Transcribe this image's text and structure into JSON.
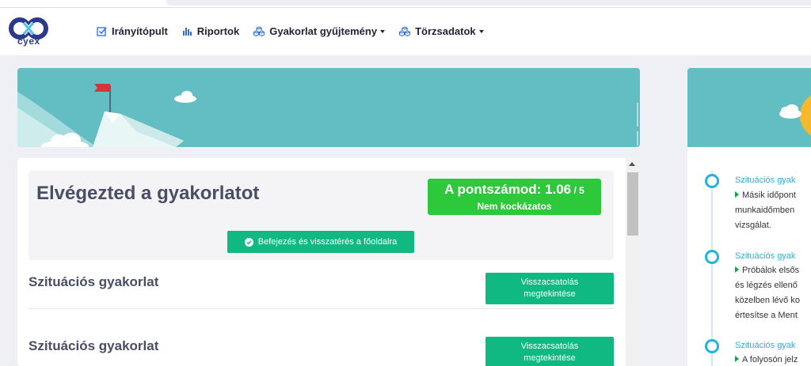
{
  "app": {
    "logo_text": "cyex"
  },
  "nav": {
    "items": [
      {
        "label": "Irányítópult",
        "icon": "checkbox-icon",
        "dropdown": false
      },
      {
        "label": "Riportok",
        "icon": "bar-chart-icon",
        "dropdown": false
      },
      {
        "label": "Gyakorlat gyűjtemény",
        "icon": "cubes-icon",
        "dropdown": true
      },
      {
        "label": "Törzsadatok",
        "icon": "cubes-icon",
        "dropdown": true
      }
    ]
  },
  "result": {
    "title": "Elvégezted a gyakorlatot",
    "score_label": "A pontszámod: 1.06",
    "score_max": " / 5",
    "risk_label": "Nem kockázatos",
    "finish_button": "Befejezés és visszatérés a főoldalra"
  },
  "sections": [
    {
      "title": "Szituációs gyakorlat",
      "button_line1": "Visszacsatolás",
      "button_line2": "megtekintése"
    },
    {
      "title": "Szituációs gyakorlat",
      "button_line1": "Visszacsatolás",
      "button_line2": "megtekintése"
    }
  ],
  "timeline": [
    {
      "title": "Szituációs gyak",
      "lines": [
        "Másik időpont",
        "munkaidőmben",
        "vizsgálat."
      ]
    },
    {
      "title": "Szituációs gyak",
      "lines": [
        "Próbálok elsős",
        "és légzés ellenő",
        "közelben lévő ko",
        "értesítse a Ment"
      ]
    },
    {
      "title": "Szituációs gyak",
      "lines": [
        "A folyosón jelz"
      ]
    }
  ],
  "colors": {
    "accent_green": "#10b981",
    "score_green": "#2ec93a",
    "banner_teal": "#63bec3",
    "timeline_blue": "#22b2e0",
    "brand_navy": "#2b3a8c"
  }
}
